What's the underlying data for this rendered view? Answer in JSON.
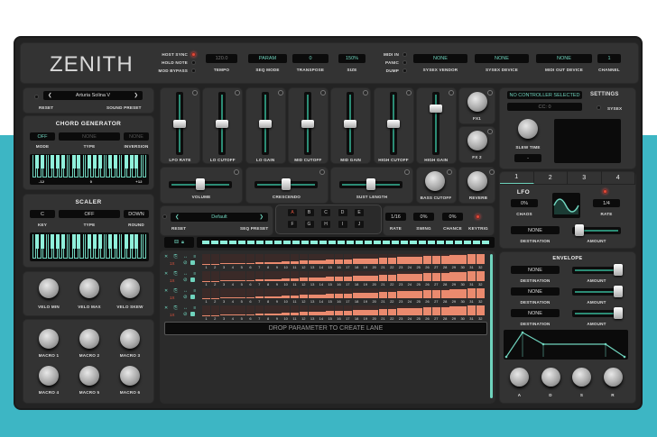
{
  "header": {
    "logo": "ZENITH",
    "toggles": [
      {
        "label": "HOST SYNC",
        "on": true
      },
      {
        "label": "HOLD NOTE",
        "on": false
      },
      {
        "label": "MOD BYPASS",
        "on": false
      }
    ],
    "tempo": {
      "value": "120.0",
      "label": "TEMPO"
    },
    "seq_mode": {
      "value": "PARAM",
      "label": "SEQ MODE"
    },
    "transpose": {
      "value": "0",
      "label": "TRANSPOSE"
    },
    "size": {
      "value": "150%",
      "label": "SIZE"
    },
    "midi_buttons": [
      "MIDI IN",
      "PANIC",
      "DUMP"
    ],
    "sysex_vendor": {
      "value": "NONE",
      "label": "SYSEX VENDOR"
    },
    "sysex_device": {
      "value": "NONE",
      "label": "SYSEX DEVICE"
    },
    "midi_out": {
      "value": "NONE",
      "label": "MIDI OUT DEVICE"
    },
    "channel": {
      "value": "1",
      "label": "CHANNEL"
    }
  },
  "sound_preset": {
    "value": "Arturia Solina V",
    "reset": "RESET",
    "label": "SOUND PRESET",
    "prev": "❮",
    "next": "❯"
  },
  "chord": {
    "title": "CHORD GENERATOR",
    "mode": "OFF",
    "type": "NONE",
    "inversion": "NONE",
    "mode_label": "MODE",
    "type_label": "TYPE",
    "inversion_label": "INVERSION",
    "scale": [
      "-12",
      "0",
      "+12"
    ]
  },
  "scaler": {
    "title": "SCALER",
    "key": "C",
    "type": "OFF",
    "round": "DOWN",
    "key_label": "KEY",
    "type_label": "TYPE",
    "round_label": "ROUND"
  },
  "velo_knobs": [
    "VELO MIN",
    "VELO MAX",
    "VELO SKEW"
  ],
  "macros": [
    "MACRO 1",
    "MACRO 2",
    "MACRO 3",
    "MACRO 4",
    "MACRO 5",
    "MACRO 6"
  ],
  "faders": [
    {
      "label": "LFO RATE",
      "value": 0.5
    },
    {
      "label": "LO CUTOFF",
      "value": 0.5
    },
    {
      "label": "LO GAIN",
      "value": 0.5
    },
    {
      "label": "MID CUTOFF",
      "value": 0.5
    },
    {
      "label": "MID GAIN",
      "value": 0.5
    },
    {
      "label": "HIGH CUTOFF",
      "value": 0.5
    },
    {
      "label": "HIGH GAIN",
      "value": 0.75
    }
  ],
  "fx_knobs": [
    "FX1",
    "FX 2"
  ],
  "hsliders": [
    {
      "label": "VOLUME",
      "value": 0.5
    },
    {
      "label": "CRESCENDO",
      "value": 0.5
    },
    {
      "label": "SUST LENGTH",
      "value": 0.5
    }
  ],
  "bass_cutoff": "BASS CUTOFF",
  "reverb": "REVERB",
  "seq": {
    "preset": "Default",
    "reset": "RESET",
    "preset_label": "SEQ PRESET",
    "prev": "❮",
    "next": "❯",
    "patterns": [
      "A",
      "B",
      "C",
      "D",
      "E",
      "F",
      "G",
      "H",
      "I",
      "J"
    ],
    "active_pattern": "A",
    "rate": {
      "value": "1/16",
      "label": "RATE"
    },
    "swing": {
      "value": "0%",
      "label": "SWING"
    },
    "chance": {
      "value": "0%",
      "label": "CHANCE"
    },
    "keytrig": "KEYTRIG",
    "lanes": [
      {
        "mult": "1X"
      },
      {
        "mult": "1X"
      },
      {
        "mult": "1X"
      },
      {
        "mult": "1X"
      }
    ],
    "step_levels": [
      0.02,
      0.03,
      0.05,
      0.08,
      0.1,
      0.13,
      0.16,
      0.19,
      0.22,
      0.26,
      0.29,
      0.32,
      0.36,
      0.39,
      0.42,
      0.46,
      0.49,
      0.52,
      0.56,
      0.59,
      0.62,
      0.66,
      0.69,
      0.72,
      0.76,
      0.79,
      0.82,
      0.86,
      0.89,
      0.92,
      0.96,
      1.0
    ],
    "drop": "DROP PARAMETER TO CREATE LANE"
  },
  "controller": {
    "name": "NO CONTROLLER SELECTED",
    "cc": "CC: 0",
    "settings": "SETTINGS",
    "sysex": "SYSEX",
    "slew": "SLEW TIME",
    "slew_value": "-"
  },
  "mod_tabs": [
    "1",
    "2",
    "3",
    "4"
  ],
  "lfo": {
    "title": "LFO",
    "chaos": "0%",
    "chaos_label": "CHAOS",
    "rate": "1/4",
    "rate_label": "RATE",
    "destination": "NONE",
    "dest_label": "DESTINATION",
    "amount_label": "AMOUNT",
    "amount": 0.05
  },
  "envelope": {
    "title": "ENVELOPE",
    "rows": [
      {
        "dest": "NONE",
        "amount": 1
      },
      {
        "dest": "NONE",
        "amount": 1
      },
      {
        "dest": "NONE",
        "amount": 1
      }
    ],
    "dest_label": "DESTINATION",
    "amount_label": "AMOUNT",
    "knobs": [
      "A",
      "D",
      "S",
      "R"
    ]
  },
  "colors": {
    "accent": "#6fd3bd",
    "step": "#ea8a6e",
    "led": "#e24a3a"
  }
}
